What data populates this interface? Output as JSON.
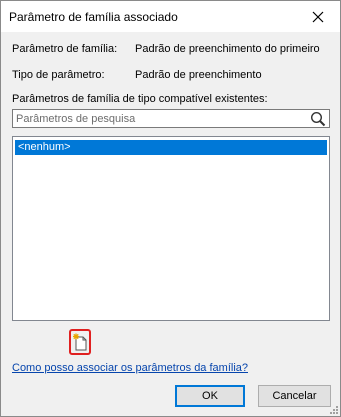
{
  "window": {
    "title": "Parâmetro de família associado"
  },
  "info": {
    "family_param_label": "Parâmetro de família:",
    "family_param_value": "Padrão de preenchimento do primeiro",
    "param_type_label": "Tipo de parâmetro:",
    "param_type_value": "Padrão de preenchimento"
  },
  "existing": {
    "label": "Parâmetros de família de tipo compatível existentes:",
    "search_placeholder": "Parâmetros de pesquisa",
    "search_value": "",
    "items": [
      {
        "label": "<nenhum>",
        "selected": true
      }
    ]
  },
  "help_link": "Como posso associar os parâmetros da família?",
  "buttons": {
    "ok": "OK",
    "cancel": "Cancelar"
  },
  "colors": {
    "selection": "#0078d7",
    "highlight_border": "#e02020",
    "link": "#0645ad"
  },
  "icons": {
    "close": "close-icon",
    "search": "search-icon",
    "new_parameter": "new-parameter-icon"
  }
}
